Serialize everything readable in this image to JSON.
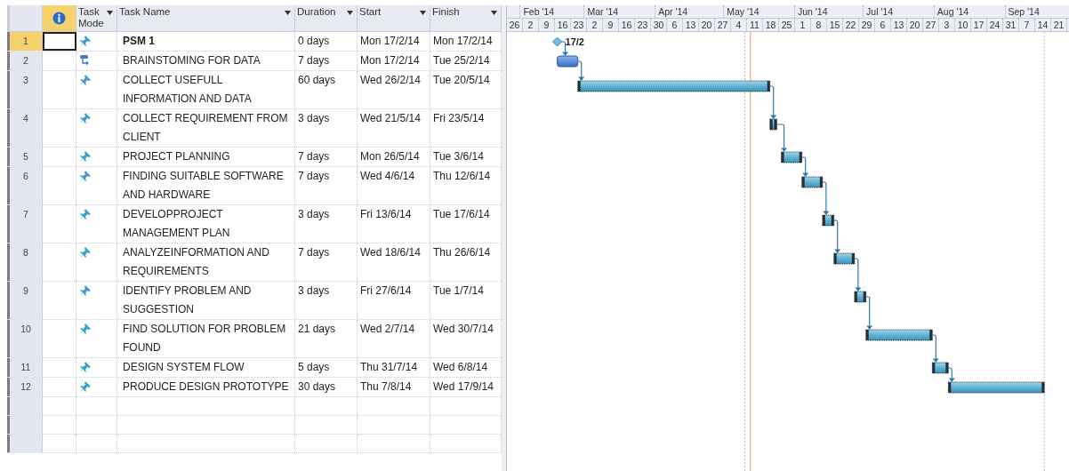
{
  "columns": [
    {
      "kind": "mode",
      "label": "Task Mode"
    },
    {
      "kind": "name",
      "label": "Task Name"
    },
    {
      "kind": "duration",
      "label": "Duration"
    },
    {
      "kind": "start",
      "label": "Start"
    },
    {
      "kind": "finish",
      "label": "Finish"
    }
  ],
  "timescale": {
    "months": [
      "Feb '14",
      "Mar '14",
      "Apr '14",
      "May '14",
      "Jun '14",
      "Jul '14",
      "Aug '14",
      "Sep '14"
    ],
    "weeks": [
      "26",
      "2",
      "9",
      "16",
      "23",
      "2",
      "9",
      "16",
      "23",
      "30",
      "6",
      "13",
      "20",
      "27",
      "4",
      "11",
      "18",
      "25",
      "1",
      "8",
      "15",
      "22",
      "29",
      "6",
      "13",
      "20",
      "27",
      "3",
      "10",
      "17",
      "24",
      "31",
      "7",
      "14",
      "21"
    ]
  },
  "tasks": [
    {
      "id": "1",
      "selected": true,
      "kind": "manual",
      "milestone": true,
      "name": "PSM 1",
      "duration": "0 days",
      "start": "Mon 17/2/14",
      "finish": "Mon 17/2/14",
      "label": "17/2"
    },
    {
      "id": "2",
      "selected": false,
      "kind": "auto",
      "milestone": false,
      "name": "BRAINSTOMING FOR DATA",
      "duration": "7 days",
      "start": "Mon 17/2/14",
      "finish": "Tue 25/2/14"
    },
    {
      "id": "3",
      "selected": false,
      "kind": "manual",
      "milestone": false,
      "name": "COLLECT USEFULL INFORMATION AND DATA",
      "duration": "60 days",
      "start": "Wed 26/2/14",
      "finish": "Tue 20/5/14"
    },
    {
      "id": "4",
      "selected": false,
      "kind": "manual",
      "milestone": false,
      "name": "COLLECT REQUIREMENT FROM CLIENT",
      "duration": "3 days",
      "start": "Wed 21/5/14",
      "finish": "Fri 23/5/14"
    },
    {
      "id": "5",
      "selected": false,
      "kind": "manual",
      "milestone": false,
      "name": "PROJECT PLANNING",
      "duration": "7 days",
      "start": "Mon 26/5/14",
      "finish": "Tue 3/6/14"
    },
    {
      "id": "6",
      "selected": false,
      "kind": "manual",
      "milestone": false,
      "name": "FINDING SUITABLE SOFTWARE AND HARDWARE",
      "duration": "7 days",
      "start": "Wed 4/6/14",
      "finish": "Thu 12/6/14"
    },
    {
      "id": "7",
      "selected": false,
      "kind": "manual",
      "milestone": false,
      "name": "DEVELOPPROJECT MANAGEMENT PLAN",
      "duration": "3 days",
      "start": "Fri 13/6/14",
      "finish": "Tue 17/6/14"
    },
    {
      "id": "8",
      "selected": false,
      "kind": "manual",
      "milestone": false,
      "name": "ANALYZEINFORMATION AND REQUIREMENTS",
      "duration": "7 days",
      "start": "Wed 18/6/14",
      "finish": "Thu 26/6/14"
    },
    {
      "id": "9",
      "selected": false,
      "kind": "manual",
      "milestone": false,
      "name": "IDENTIFY PROBLEM AND SUGGESTION",
      "duration": "3 days",
      "start": "Fri 27/6/14",
      "finish": "Tue 1/7/14"
    },
    {
      "id": "10",
      "selected": false,
      "kind": "manual",
      "milestone": false,
      "name": "FIND SOLUTION FOR PROBLEM FOUND",
      "duration": "21 days",
      "start": "Wed 2/7/14",
      "finish": "Wed 30/7/14"
    },
    {
      "id": "11",
      "selected": false,
      "kind": "manual",
      "milestone": false,
      "name": "DESIGN SYSTEM FLOW",
      "duration": "5 days",
      "start": "Thu 31/7/14",
      "finish": "Wed 6/8/14"
    },
    {
      "id": "12",
      "selected": false,
      "kind": "manual",
      "milestone": false,
      "name": "PRODUCE DESIGN PROTOTYPE",
      "duration": "30 days",
      "start": "Thu 7/8/14",
      "finish": "Wed 17/9/14"
    }
  ]
}
